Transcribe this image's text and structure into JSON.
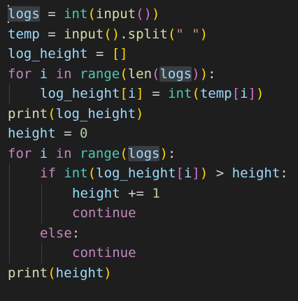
{
  "colors": {
    "background": "#1e1e1e",
    "variable": "#9cdcfe",
    "function": "#dcdcaa",
    "builtin_type": "#4ec9b0",
    "keyword_flow": "#c586c0",
    "keyword_storage": "#569cd6",
    "string": "#ce9178",
    "number": "#b5cea8",
    "operator": "#d4d4d4",
    "bracket1": "#ffd700",
    "bracket2": "#da70d6",
    "bracket3": "#179fff",
    "word_highlight": "#3a3d41"
  },
  "code_lines": [
    {
      "indent": 0,
      "tokens": [
        {
          "t": "logs",
          "c": "variable",
          "hl": true
        },
        {
          "t": " = ",
          "c": "operator"
        },
        {
          "t": "int",
          "c": "builtin_type"
        },
        {
          "t": "(",
          "c": "bracket1"
        },
        {
          "t": "input",
          "c": "function"
        },
        {
          "t": "()",
          "c": "bracket2"
        },
        {
          "t": ")",
          "c": "bracket1"
        }
      ]
    },
    {
      "indent": 0,
      "tokens": [
        {
          "t": "temp",
          "c": "variable"
        },
        {
          "t": " = ",
          "c": "operator"
        },
        {
          "t": "input",
          "c": "function"
        },
        {
          "t": "()",
          "c": "bracket1"
        },
        {
          "t": ".",
          "c": "operator"
        },
        {
          "t": "split",
          "c": "function"
        },
        {
          "t": "(",
          "c": "bracket1"
        },
        {
          "t": "\" \"",
          "c": "string"
        },
        {
          "t": ")",
          "c": "bracket1"
        }
      ]
    },
    {
      "indent": 0,
      "tokens": [
        {
          "t": "log_height",
          "c": "variable"
        },
        {
          "t": " = ",
          "c": "operator"
        },
        {
          "t": "[]",
          "c": "bracket1"
        }
      ]
    },
    {
      "indent": 0,
      "tokens": [
        {
          "t": "for",
          "c": "keyword_flow"
        },
        {
          "t": " ",
          "c": "operator"
        },
        {
          "t": "i",
          "c": "variable"
        },
        {
          "t": " ",
          "c": "operator"
        },
        {
          "t": "in",
          "c": "keyword_flow"
        },
        {
          "t": " ",
          "c": "operator"
        },
        {
          "t": "range",
          "c": "builtin_type"
        },
        {
          "t": "(",
          "c": "bracket1"
        },
        {
          "t": "len",
          "c": "function"
        },
        {
          "t": "(",
          "c": "bracket2"
        },
        {
          "t": "logs",
          "c": "variable",
          "hl": true
        },
        {
          "t": ")",
          "c": "bracket2"
        },
        {
          "t": ")",
          "c": "bracket1"
        },
        {
          "t": ":",
          "c": "operator"
        }
      ]
    },
    {
      "indent": 1,
      "tokens": [
        {
          "t": "log_height",
          "c": "variable"
        },
        {
          "t": "[",
          "c": "bracket1"
        },
        {
          "t": "i",
          "c": "variable"
        },
        {
          "t": "]",
          "c": "bracket1"
        },
        {
          "t": " = ",
          "c": "operator"
        },
        {
          "t": "int",
          "c": "builtin_type"
        },
        {
          "t": "(",
          "c": "bracket1"
        },
        {
          "t": "temp",
          "c": "variable"
        },
        {
          "t": "[",
          "c": "bracket2"
        },
        {
          "t": "i",
          "c": "variable"
        },
        {
          "t": "]",
          "c": "bracket2"
        },
        {
          "t": ")",
          "c": "bracket1"
        }
      ]
    },
    {
      "indent": 0,
      "tokens": [
        {
          "t": "print",
          "c": "function"
        },
        {
          "t": "(",
          "c": "bracket1"
        },
        {
          "t": "log_height",
          "c": "variable"
        },
        {
          "t": ")",
          "c": "bracket1"
        }
      ]
    },
    {
      "indent": 0,
      "tokens": [
        {
          "t": "height",
          "c": "variable"
        },
        {
          "t": " = ",
          "c": "operator"
        },
        {
          "t": "0",
          "c": "number"
        }
      ]
    },
    {
      "indent": 0,
      "tokens": [
        {
          "t": "for",
          "c": "keyword_flow"
        },
        {
          "t": " ",
          "c": "operator"
        },
        {
          "t": "i",
          "c": "variable"
        },
        {
          "t": " ",
          "c": "operator"
        },
        {
          "t": "in",
          "c": "keyword_flow"
        },
        {
          "t": " ",
          "c": "operator"
        },
        {
          "t": "range",
          "c": "builtin_type"
        },
        {
          "t": "(",
          "c": "bracket1"
        },
        {
          "t": "logs",
          "c": "variable",
          "hl": true
        },
        {
          "t": ")",
          "c": "bracket1"
        },
        {
          "t": ":",
          "c": "operator"
        }
      ]
    },
    {
      "indent": 1,
      "tokens": [
        {
          "t": "if",
          "c": "keyword_flow"
        },
        {
          "t": " ",
          "c": "operator"
        },
        {
          "t": "int",
          "c": "builtin_type"
        },
        {
          "t": "(",
          "c": "bracket1"
        },
        {
          "t": "log_height",
          "c": "variable"
        },
        {
          "t": "[",
          "c": "bracket2"
        },
        {
          "t": "i",
          "c": "variable"
        },
        {
          "t": "]",
          "c": "bracket2"
        },
        {
          "t": ")",
          "c": "bracket1"
        },
        {
          "t": " > ",
          "c": "operator"
        },
        {
          "t": "height",
          "c": "variable"
        },
        {
          "t": ":",
          "c": "operator"
        }
      ]
    },
    {
      "indent": 2,
      "tokens": [
        {
          "t": "height",
          "c": "variable"
        },
        {
          "t": " += ",
          "c": "operator"
        },
        {
          "t": "1",
          "c": "number"
        }
      ]
    },
    {
      "indent": 2,
      "tokens": [
        {
          "t": "continue",
          "c": "keyword_flow"
        }
      ]
    },
    {
      "indent": 1,
      "tokens": [
        {
          "t": "else",
          "c": "keyword_flow"
        },
        {
          "t": ":",
          "c": "operator"
        }
      ]
    },
    {
      "indent": 2,
      "tokens": [
        {
          "t": "continue",
          "c": "keyword_flow"
        }
      ]
    },
    {
      "indent": 0,
      "tokens": [
        {
          "t": "print",
          "c": "function"
        },
        {
          "t": "(",
          "c": "bracket1"
        },
        {
          "t": "height",
          "c": "variable"
        },
        {
          "t": ")",
          "c": "bracket1"
        }
      ]
    }
  ]
}
